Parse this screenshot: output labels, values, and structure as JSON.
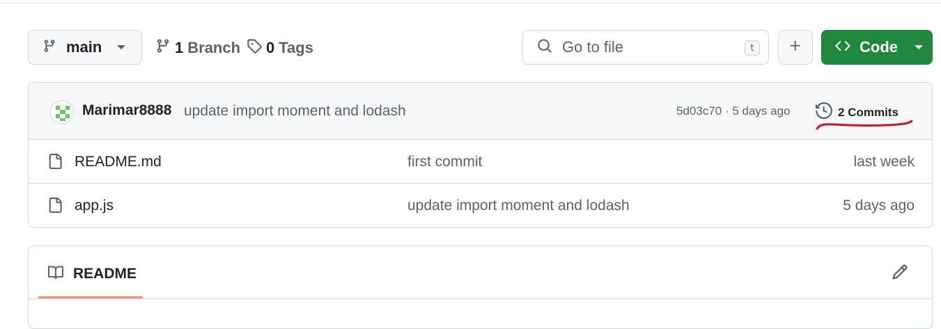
{
  "toolbar": {
    "branch_select": {
      "label": "main",
      "icon": "git-branch-icon"
    },
    "branches": {
      "count": "1",
      "label": "Branch",
      "icon": "git-branch-icon"
    },
    "tags": {
      "count": "0",
      "label": "Tags",
      "icon": "tag-icon"
    },
    "search": {
      "placeholder": "Go to file",
      "shortcut": "t",
      "icon": "search-icon"
    },
    "add_button": {
      "icon": "plus-icon"
    },
    "code_button": {
      "label": "Code",
      "icon": "code-icon",
      "color": "#1f883d"
    }
  },
  "latest_commit": {
    "author": "Marimar8888",
    "message": "update import moment and lodash",
    "meta": "5d03c70 · 5 days ago",
    "commits_count_label": "2 Commits",
    "icon": "history-icon"
  },
  "files": [
    {
      "name": "README.md",
      "message": "first commit",
      "date": "last week",
      "icon": "file-icon"
    },
    {
      "name": "app.js",
      "message": "update import moment and lodash",
      "date": "5 days ago",
      "icon": "file-icon"
    }
  ],
  "readme": {
    "title": "README",
    "icon": "book-icon",
    "edit_icon": "pencil-icon",
    "underline_color": "#fd8c73"
  }
}
